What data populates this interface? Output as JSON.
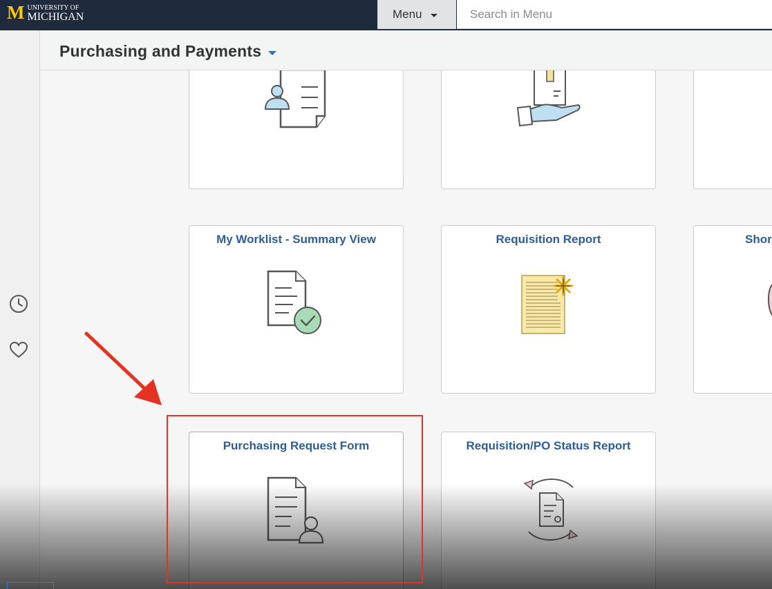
{
  "branding": {
    "logo_letter": "M",
    "logo_line1": "UNIVERSITY OF",
    "logo_line2": "MICHIGAN"
  },
  "topbar": {
    "menu_label": "Menu",
    "search_placeholder": "Search in Menu"
  },
  "rail": {
    "icons": [
      "clock-icon",
      "heart-icon"
    ]
  },
  "header": {
    "title": "Purchasing and Payments"
  },
  "tiles": {
    "row2": [
      {
        "title": "My Worklist - Summary View",
        "icon": "document-check-icon"
      },
      {
        "title": "Requisition Report",
        "icon": "report-star-icon"
      },
      {
        "title": "Shor",
        "icon": "partial-circle-icon"
      }
    ],
    "row3": [
      {
        "title": "Purchasing Request Form",
        "icon": "document-user-icon"
      },
      {
        "title": "Requisition/PO Status Report",
        "icon": "document-refresh-icon"
      }
    ]
  },
  "colors": {
    "topbar": "#1f2a3c",
    "michigan_maize": "#ffcb05",
    "tile_title": "#2d5d95",
    "highlight_box": "#e53323"
  }
}
